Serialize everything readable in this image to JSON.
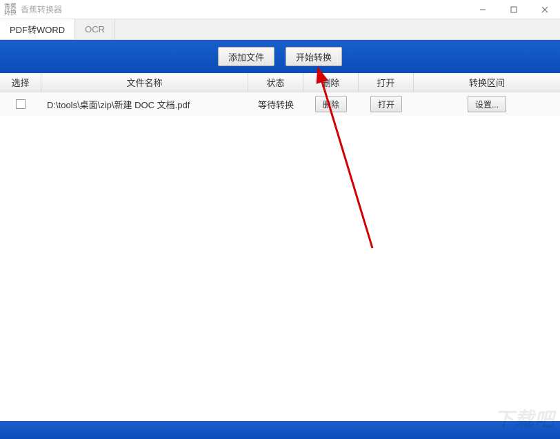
{
  "window": {
    "logo_line1": "香蕉",
    "logo_line2": "转换",
    "title": "香蕉转换器"
  },
  "tabs": {
    "pdf_word": "PDF转WORD",
    "ocr": "OCR"
  },
  "toolbar": {
    "add_file": "添加文件",
    "start_convert": "开始转换"
  },
  "headers": {
    "select": "选择",
    "filename": "文件名称",
    "status": "状态",
    "delete": "删除",
    "open": "打开",
    "range": "转换区间"
  },
  "rows": [
    {
      "filename": "D:\\tools\\桌面\\zip\\新建 DOC 文档.pdf",
      "status": "等待转换",
      "delete_btn": "删除",
      "open_btn": "打开",
      "range_btn": "设置..."
    }
  ],
  "watermark": "下载吧"
}
